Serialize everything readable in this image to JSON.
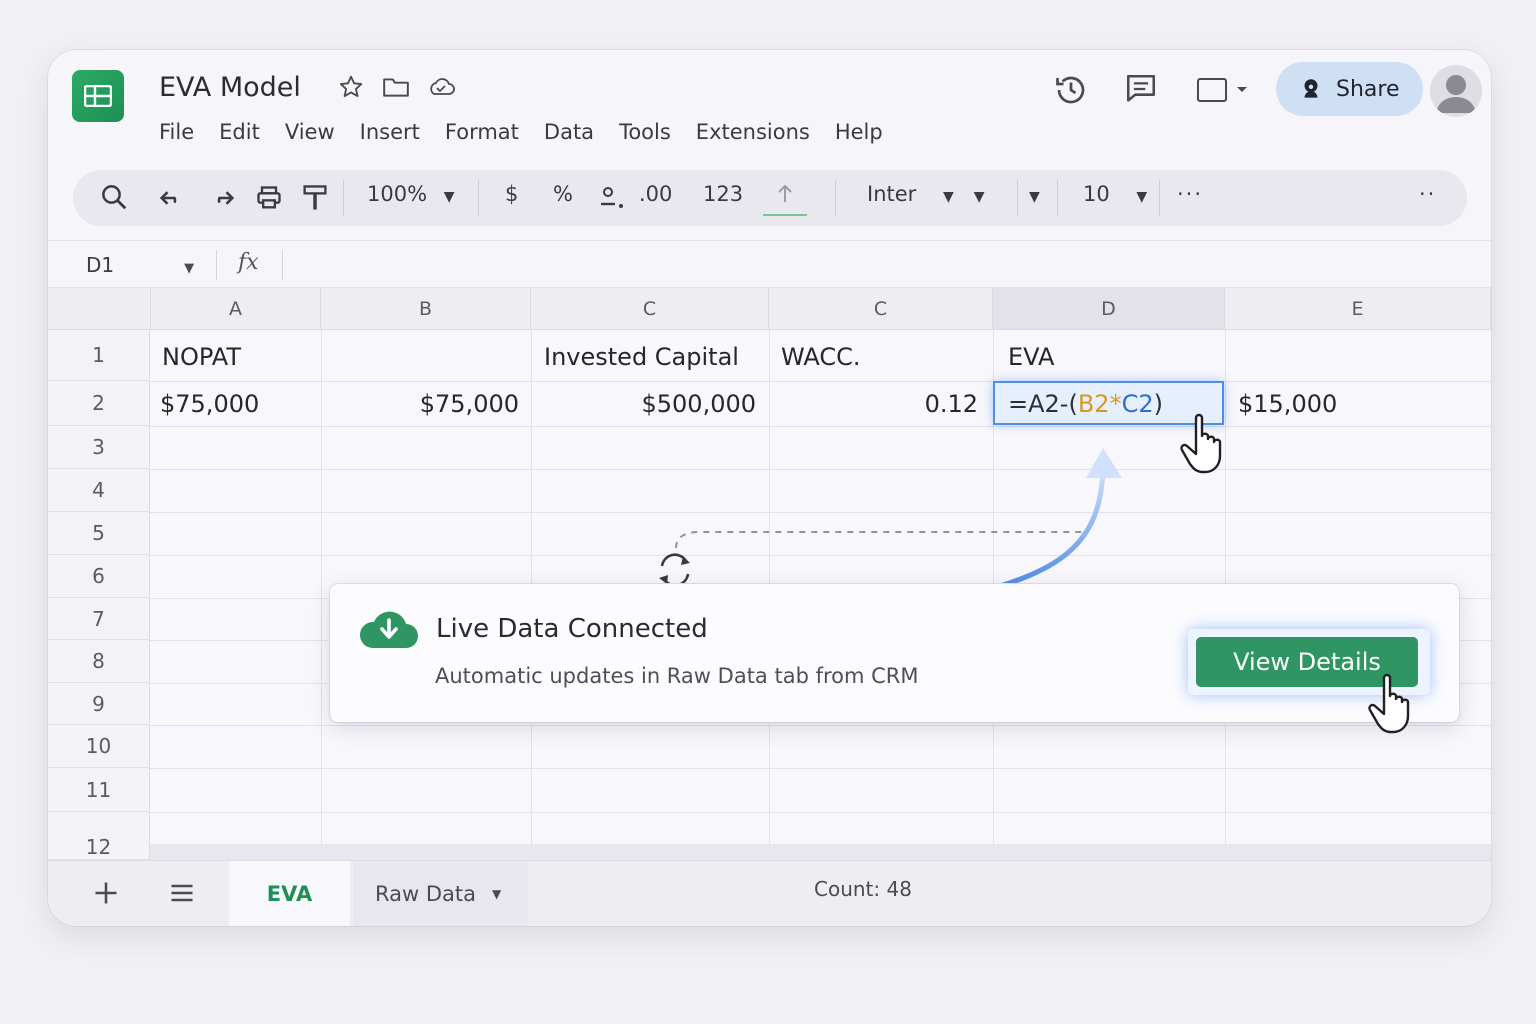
{
  "app": {
    "doc_title": "EVA Model",
    "menu": [
      "File",
      "Edit",
      "View",
      "Insert",
      "Format",
      "Data",
      "Tools",
      "Extensions",
      "Help"
    ],
    "share_label": "Share"
  },
  "toolbar": {
    "zoom": "100%",
    "currency": "$",
    "percent": "%",
    "decimal_increase": ".00",
    "number_format": "123",
    "font": "Inter",
    "font_size": "10",
    "more": "···",
    "overflow": "··"
  },
  "formula_bar": {
    "name_box": "D1",
    "fx_label": "fx"
  },
  "grid": {
    "columns": [
      "A",
      "B",
      "C",
      "C",
      "D",
      "E"
    ],
    "rows": [
      "1",
      "2",
      "3",
      "4",
      "5",
      "6",
      "7",
      "8",
      "9",
      "10",
      "11",
      "12"
    ],
    "row1": {
      "A": "NOPAT",
      "C": "Invested Capital",
      "C2": "WACC.",
      "D": "EVA"
    },
    "row2": {
      "A": "$75,000",
      "B": "$75,000",
      "C": "$500,000",
      "C2": "0.12",
      "E": "$15,000"
    },
    "formula_parts": [
      "=A2-(",
      "B2",
      "*",
      "C2",
      ")"
    ]
  },
  "notification": {
    "title": "Live Data Connected",
    "subtitle": "Automatic updates in Raw Data tab from CRM",
    "button_label": "View Details"
  },
  "sheet_tabs": {
    "active": "EVA",
    "other": "Raw Data",
    "status": "Count: 48"
  },
  "colors": {
    "accent_green": "#2e9563",
    "selection_blue": "#4d8ee8",
    "share_bg": "#cfe0f4"
  }
}
